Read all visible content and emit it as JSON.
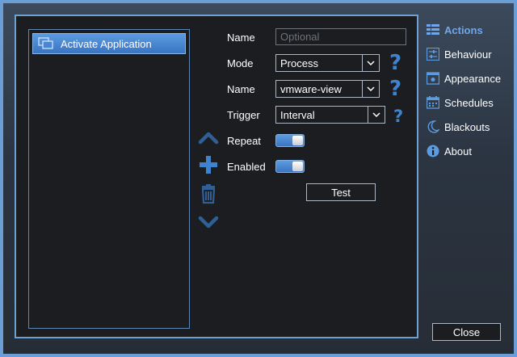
{
  "list": {
    "items": [
      {
        "label": "Activate Application",
        "icon": "application-windows-icon"
      }
    ]
  },
  "form": {
    "name_label": "Name",
    "name_placeholder": "Optional",
    "name_value": "",
    "mode_label": "Mode",
    "mode_value": "Process",
    "process_label": "Name",
    "process_value": "vmware-view",
    "trigger_label": "Trigger",
    "trigger_value": "Interval",
    "repeat_label": "Repeat",
    "repeat_on": true,
    "enabled_label": "Enabled",
    "enabled_on": true,
    "test_label": "Test",
    "help_glyph": "?"
  },
  "nav": {
    "items": [
      {
        "label": "Actions",
        "icon": "list-icon",
        "active": true
      },
      {
        "label": "Behaviour",
        "icon": "sliders-icon",
        "active": false
      },
      {
        "label": "Appearance",
        "icon": "monitor-icon",
        "active": false
      },
      {
        "label": "Schedules",
        "icon": "calendar-icon",
        "active": false
      },
      {
        "label": "Blackouts",
        "icon": "moon-icon",
        "active": false
      },
      {
        "label": "About",
        "icon": "info-icon",
        "active": false
      }
    ]
  },
  "footer": {
    "close_label": "Close"
  },
  "colors": {
    "accent": "#3f83cf",
    "active_nav": "#6fa7ea",
    "window_border": "#6b9ed4",
    "panel_bg": "#1b1d21"
  }
}
